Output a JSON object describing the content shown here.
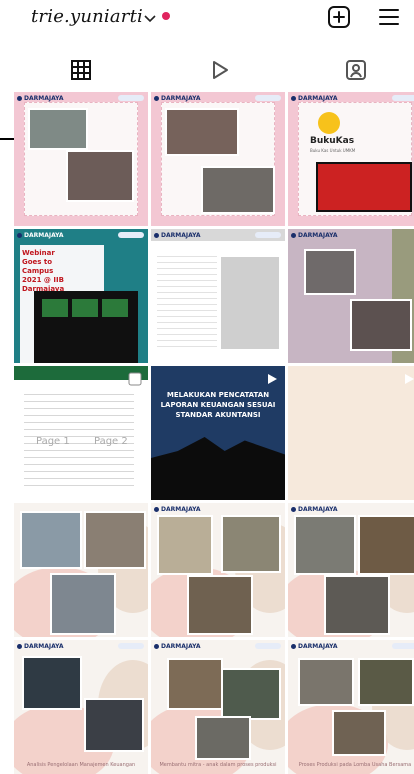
{
  "header": {
    "username": "trie.yuniarti",
    "icons": [
      "chevron-down-icon",
      "notification-dot",
      "add-post-icon",
      "menu-icon"
    ]
  },
  "tabs": [
    {
      "name": "posts-grid-tab",
      "icon": "grid-icon"
    },
    {
      "name": "reels-tab",
      "icon": "play-icon"
    },
    {
      "name": "tagged-tab",
      "icon": "tagged-person-icon"
    }
  ],
  "posts": [
    {
      "brand": "DARMAJAYA"
    },
    {
      "brand": "DARMAJAYA"
    },
    {
      "brand": "DARMAJAYA",
      "app": "BukuKas",
      "app_sub": "Buku Kas Untuk UMKM"
    },
    {
      "brand": "DARMAJAYA",
      "text": "Webinar Goes to Campus 2021 @ IIB Darmajaya"
    },
    {
      "brand": "DARMAJAYA"
    },
    {
      "brand": "DARMAJAYA"
    },
    {
      "page_label_1": "Page 1",
      "page_label_2": "Page 2"
    },
    {
      "title": "MELAKUKAN PENCATATAN LAPORAN KEUANGAN SESUAI STANDAR AKUNTANSI"
    },
    {},
    {},
    {
      "brand": "DARMAJAYA"
    },
    {
      "brand": "DARMAJAYA"
    },
    {
      "brand": "DARMAJAYA",
      "caption": "Analisis Pengelolaan Manajemen Keuangan"
    },
    {
      "brand": "DARMAJAYA",
      "caption": "Membantu mitra - anak dalam proses produksi"
    },
    {
      "brand": "DARMAJAYA",
      "caption": "Proses Produksi pada Lomba Usaha Bersama"
    }
  ],
  "colors": {
    "pink_frame": "#f3c7d3",
    "teal": "#1f7f86",
    "navy": "#1f3b64",
    "notification": "#e0245e"
  }
}
